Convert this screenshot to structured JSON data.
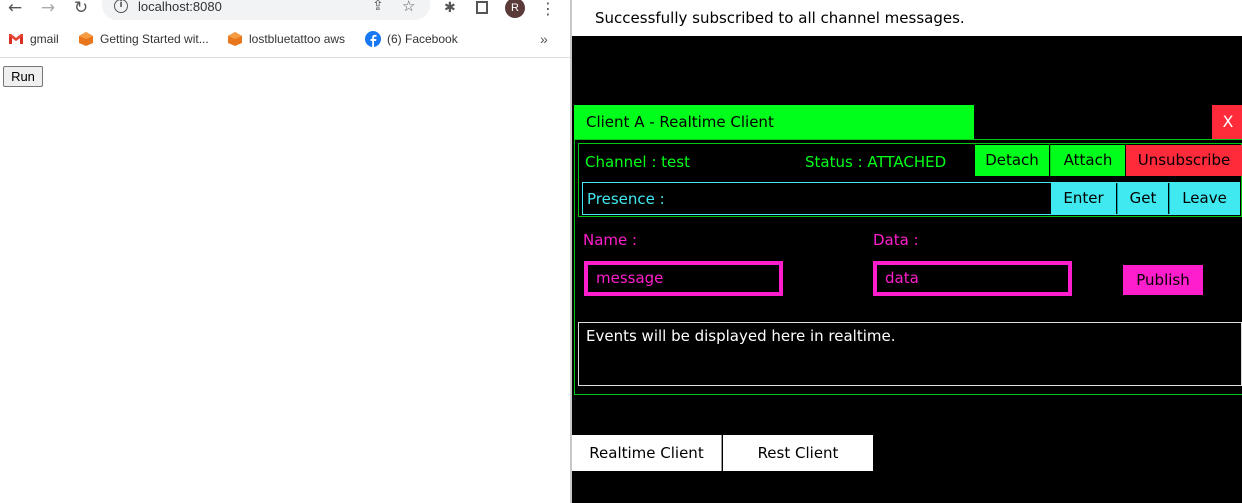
{
  "browser": {
    "url": "localhost:8080",
    "profile_initial": "R",
    "bookmarks": [
      {
        "label": "gmail",
        "icon": "gmail-icon"
      },
      {
        "label": "Getting Started wit...",
        "icon": "aws-cube-icon"
      },
      {
        "label": "lostbluetattoo aws",
        "icon": "aws-cube-icon"
      },
      {
        "label": "(6) Facebook",
        "icon": "facebook-icon"
      }
    ],
    "more_glyph": "»"
  },
  "left_page": {
    "run_label": "Run"
  },
  "app": {
    "notice": "Successfully subscribed to all channel messages.",
    "client_title": "Client A - Realtime Client",
    "close_label": "X",
    "channel_text": "Channel : test",
    "status_text": "Status : ATTACHED",
    "buttons": {
      "detach": "Detach",
      "attach": "Attach",
      "unsubscribe": "Unsubscribe"
    },
    "presence": {
      "label": "Presence :",
      "enter": "Enter",
      "get": "Get",
      "leave": "Leave"
    },
    "publish": {
      "name_label": "Name :",
      "data_label": "Data :",
      "name_placeholder": "message",
      "data_placeholder": "data",
      "publish_label": "Publish"
    },
    "events_text": "Events will be displayed here in realtime.",
    "tabs": {
      "realtime": "Realtime Client",
      "rest": "Rest Client"
    },
    "colors": {
      "green": "#00ff1a",
      "red": "#ff2b3a",
      "cyan": "#40e8f0",
      "magenta": "#ff1ecb",
      "background": "#000000"
    }
  }
}
